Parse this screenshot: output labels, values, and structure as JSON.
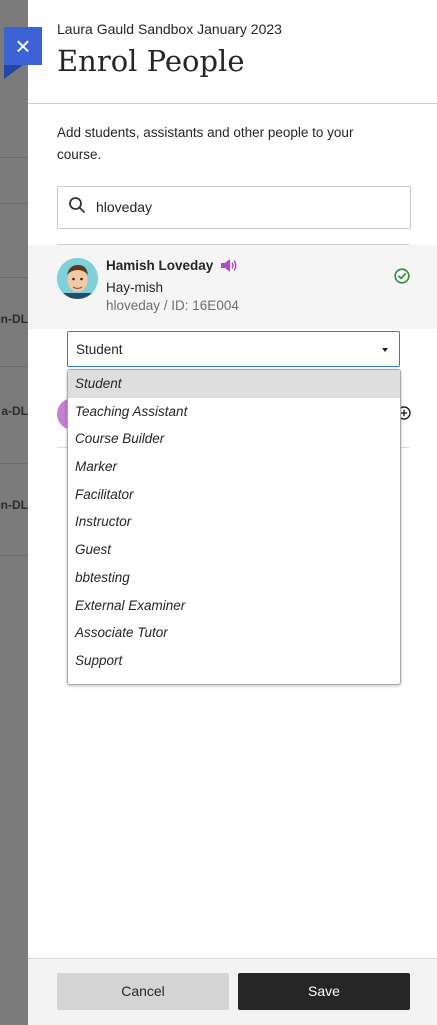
{
  "background": {
    "row_fragments": [
      "son-DL",
      "a-DL",
      "son-DL"
    ]
  },
  "header": {
    "course_name": "Laura Gauld Sandbox January 2023",
    "title": "Enrol People",
    "close_label": "×"
  },
  "intro_text": "Add students, assistants and other people to your course.",
  "search": {
    "value": "hloveday",
    "icon": "search-icon"
  },
  "result": {
    "name": "Hamish Loveday",
    "pronunciation": "Hay-mish",
    "user_id": "hloveday / ID: 16E004",
    "status_icon": "check-circle-icon",
    "audio_icon": "speaker-icon"
  },
  "role_select": {
    "selected": "Student",
    "options": [
      "Student",
      "Teaching Assistant",
      "Course Builder",
      "Marker",
      "Facilitator",
      "Instructor",
      "Guest",
      "bbtesting",
      "External Examiner",
      "Associate Tutor",
      "Support"
    ]
  },
  "footer": {
    "cancel_label": "Cancel",
    "save_label": "Save"
  },
  "colors": {
    "accent": "#3d62d6",
    "success": "#2e8b3a",
    "audio": "#b047c8",
    "primary_button": "#262626"
  }
}
